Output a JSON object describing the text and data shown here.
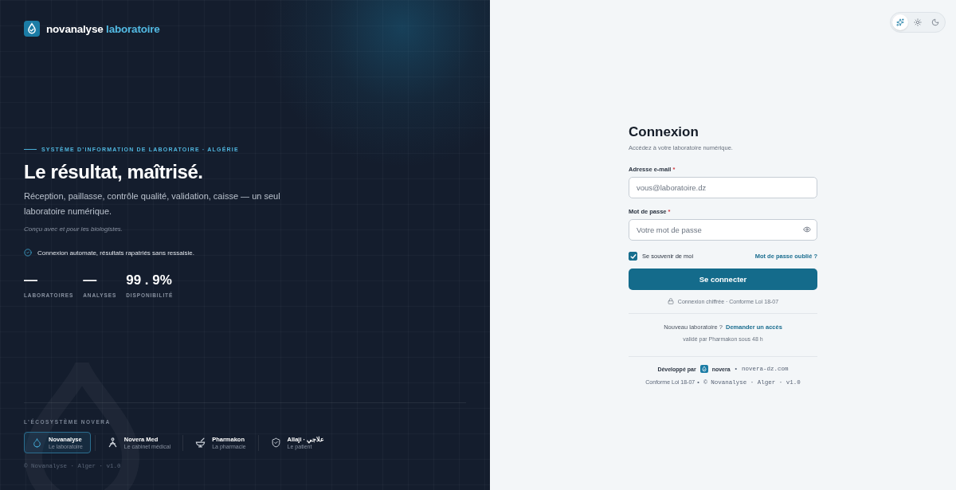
{
  "brand": {
    "name": "novanalyse",
    "suffix": "laboratoire"
  },
  "hero": {
    "eyebrow": "SYSTÈME D’INFORMATION DE LABORATOIRE · ALGÉRIE",
    "headline": "Le résultat, maîtrisé.",
    "description": "Réception, paillasse, contrôle qualité, validation, caisse — un seul laboratoire numérique.",
    "note": "Conçu avec et pour les biologistes.",
    "feature": "Connexion automate, résultats rapatriés sans ressaisie."
  },
  "stats": [
    {
      "value": "—",
      "label": "LABORATOIRES"
    },
    {
      "value": "—",
      "label": "ANALYSES"
    },
    {
      "value": "99 . 9%",
      "label": "DISPONIBILITÉ"
    }
  ],
  "ecosystem": {
    "title": "L’ÉCOSYSTÈME NOVERA",
    "items": [
      {
        "kind": "drop",
        "name": "Novanalyse",
        "subtitle": "Le laboratoire",
        "selected": true
      },
      {
        "kind": "person",
        "name": "Novera Med",
        "subtitle": "Le cabinet médical",
        "selected": false
      },
      {
        "kind": "bowl",
        "name": "Pharmakon",
        "subtitle": "La pharmacie",
        "selected": false
      },
      {
        "kind": "shield",
        "name": "Allaji · علاجي",
        "subtitle": "Le patient",
        "selected": false
      }
    ]
  },
  "left_footer": "© Novanalyse · Alger · v1.0",
  "theme_toggle": [
    {
      "kind": "auto",
      "selected": true
    },
    {
      "kind": "light",
      "selected": false
    },
    {
      "kind": "dark",
      "selected": false
    }
  ],
  "login": {
    "title": "Connexion",
    "subtitle": "Accédez à votre laboratoire numérique.",
    "fields": [
      {
        "kind": "email",
        "label": "Adresse e-mail",
        "required_mark": "*",
        "placeholder": "vous@laboratoire.dz"
      },
      {
        "kind": "password",
        "label": "Mot de passe",
        "required_mark": "*",
        "placeholder": "Votre mot de passe"
      }
    ],
    "remember": {
      "label": "Se souvenir de moi",
      "checked": true
    },
    "forgot_link": "Mot de passe oublié ?",
    "submit": "Se connecter",
    "security_note": "Connexion chiffrée · Conforme Loi 18-07",
    "signup_question": "Nouveau laboratoire ?",
    "signup_link": "Demander un accès",
    "signup_note": "validé par Pharmakon sous 48 h",
    "credit_label": "Développé par",
    "credit_name": "novera",
    "credit_separator": "•",
    "credit_site": "novera-dz.com",
    "compliance": "Conforme Loi 18-07",
    "copyright": "• © Novanalyse · Alger · v1.0"
  }
}
